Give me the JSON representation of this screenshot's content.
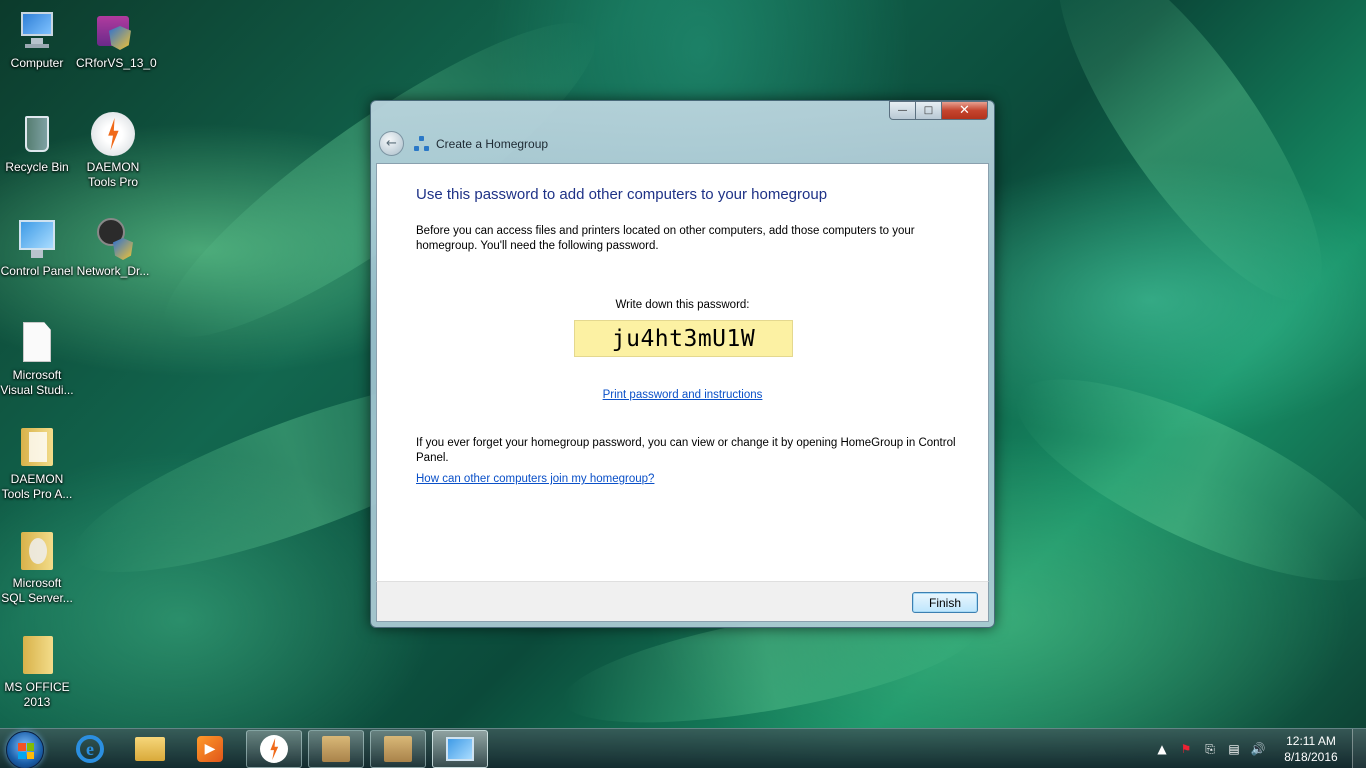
{
  "desktop": {
    "icons": [
      {
        "label": "Computer"
      },
      {
        "label": "CRforVS_13_0"
      },
      {
        "label": "Recycle Bin"
      },
      {
        "label": "DAEMON Tools Pro"
      },
      {
        "label": "Control Panel"
      },
      {
        "label": "Network_Dr..."
      },
      {
        "label": "Microsoft Visual Studi..."
      },
      {
        "label": "DAEMON Tools Pro A..."
      },
      {
        "label": "Microsoft SQL Server..."
      },
      {
        "label": "MS OFFICE 2013"
      }
    ]
  },
  "window": {
    "title": "Create a Homegroup",
    "heading": "Use this password to add other computers to your homegroup",
    "intro": "Before you can access files and printers located on other computers, add those computers to your homegroup. You'll need the following password.",
    "password_label": "Write down this password:",
    "password": "ju4ht3mU1W",
    "print_link": "Print password and instructions",
    "forget_text": "If you ever forget your homegroup password, you can view or change it by opening HomeGroup in Control Panel.",
    "help_link": "How can other computers join my homegroup?",
    "finish_label": "Finish"
  },
  "taskbar": {
    "clock_time": "12:11 AM",
    "clock_date": "8/18/2016"
  }
}
